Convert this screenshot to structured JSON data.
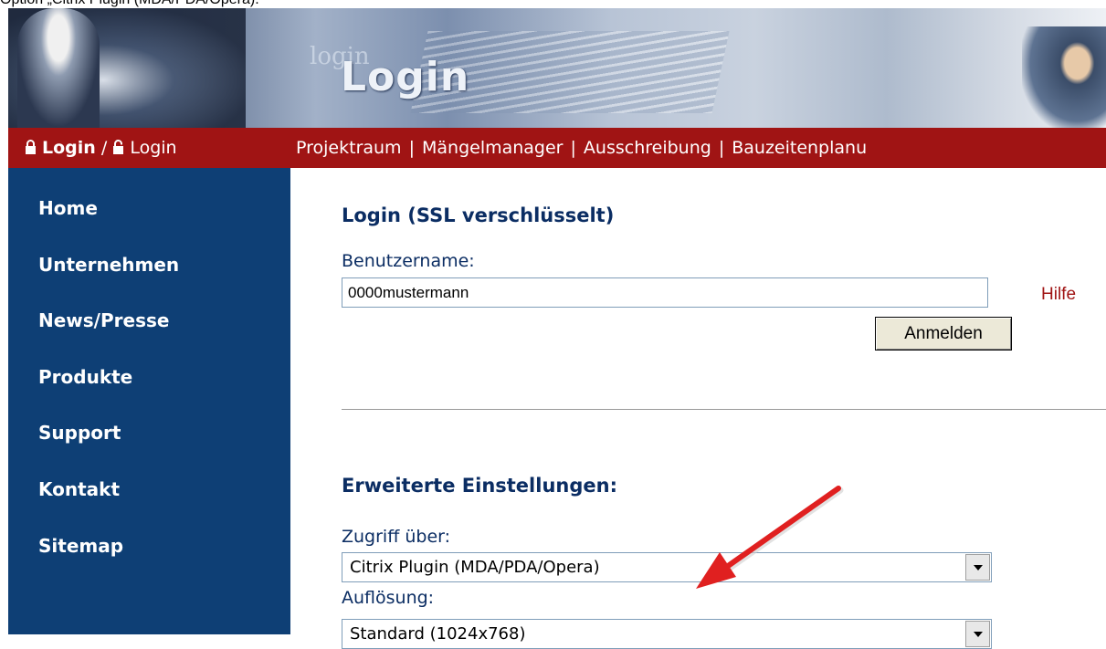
{
  "caption": "Option „Citrix Plugin (MDA/PDA/Opera).",
  "banner": {
    "ghost_text": "login",
    "title": "Login"
  },
  "topbar": {
    "login_bold": "Login",
    "login_slash": "/",
    "login_plain": "Login",
    "links": [
      "Projektraum",
      "Mängelmanager",
      "Ausschreibung",
      "Bauzeitenplanu"
    ],
    "separator": "|"
  },
  "sidebar": {
    "items": [
      "Home",
      "Unternehmen",
      "News/Presse",
      "Produkte",
      "Support",
      "Kontakt",
      "Sitemap"
    ]
  },
  "login": {
    "heading": "Login (SSL verschlüsselt)",
    "username_label": "Benutzername:",
    "username_value": "0000mustermann",
    "help_link": "Hilfe",
    "submit_label": "Anmelden"
  },
  "advanced": {
    "heading": "Erweiterte Einstellungen:",
    "access_label": "Zugriff über:",
    "access_value": "Citrix Plugin (MDA/PDA/Opera)",
    "resolution_label": "Auflösung:",
    "resolution_value": "Standard (1024x768)"
  },
  "colors": {
    "nav_red": "#a01414",
    "sidebar_blue": "#0e3f75",
    "heading_blue": "#0b2d63",
    "annotation_arrow": "#e02020"
  }
}
